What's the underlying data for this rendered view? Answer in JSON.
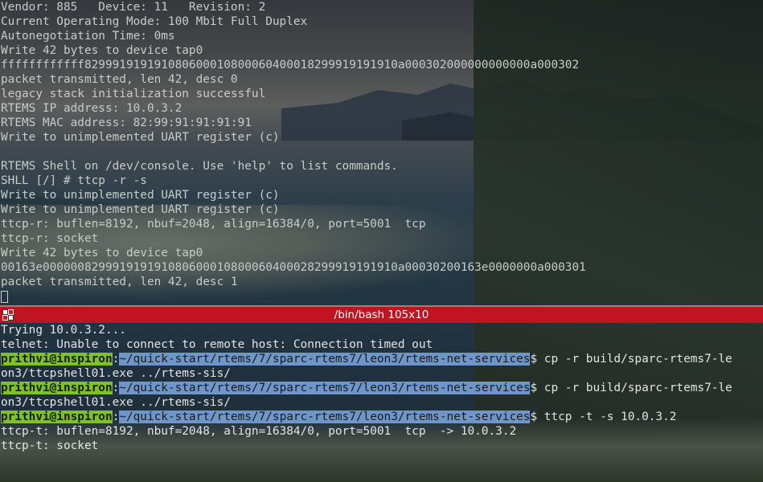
{
  "top_pane": {
    "lines": [
      "Vendor: 885   Device: 11   Revision: 2",
      "Current Operating Mode: 100 Mbit Full Duplex",
      "Autonegotiation Time: 0ms",
      "Write 42 bytes to device tap0",
      "ffffffffffff829991919191080600010800060400018299919191910a000302000000000000a000302",
      "packet transmitted, len 42, desc 0",
      "legacy stack initialization successful",
      "RTEMS IP address: 10.0.3.2",
      "RTEMS MAC address: 82:99:91:91:91:91",
      "Write to unimplemented UART register (c)",
      "",
      "RTEMS Shell on /dev/console. Use 'help' to list commands.",
      "SHLL [/] # ttcp -r -s",
      "Write to unimplemented UART register (c)",
      "Write to unimplemented UART register (c)",
      "ttcp-r: buflen=8192, nbuf=2048, align=16384/0, port=5001  tcp",
      "ttcp-r: socket",
      "Write 42 bytes to device tap0",
      "00163e000000829991919191080600010800060400028299919191910a00030200163e0000000a000301",
      "packet transmitted, len 42, desc 1"
    ]
  },
  "titlebar": {
    "title": "/bin/bash 105x10"
  },
  "bottom_pane": {
    "prompt_user": "prithvi@inspiron",
    "prompt_sep": ":",
    "prompt_path": "~/quick-start/rtems/7/sparc-rtems7/leon3/rtems-net-services",
    "lines": {
      "l1": "Trying 10.0.3.2...",
      "l2": "telnet: Unable to connect to remote host: Connection timed out",
      "cmd1": "$ cp -r build/sparc-rtems7-le",
      "cmd1_wrap": "on3/ttcpshell01.exe ../rtems-sis/",
      "cmd2": "$ cp -r build/sparc-rtems7-le",
      "cmd2_wrap": "on3/ttcpshell01.exe ../rtems-sis/",
      "cmd3": "$ ttcp -t -s 10.0.3.2",
      "l3": "ttcp-t: buflen=8192, nbuf=2048, align=16384/0, port=5001  tcp  -> 10.0.3.2",
      "l4": "ttcp-t: socket"
    }
  }
}
